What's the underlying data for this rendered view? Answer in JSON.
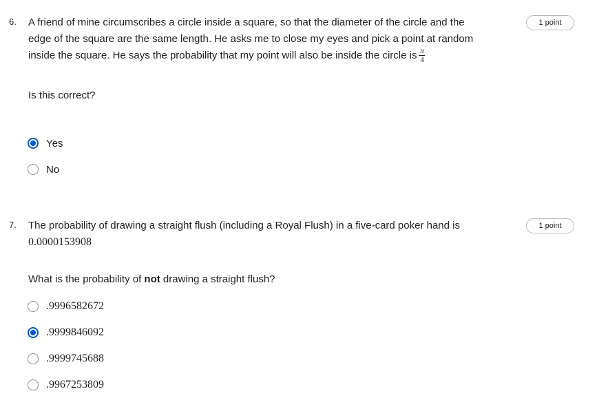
{
  "questions": [
    {
      "number": "6.",
      "points": "1 point",
      "text_lines": [
        "A friend of mine circumscribes a circle inside a square, so that the diameter of the circle and the",
        "edge of the square are the same length. He asks me to close my eyes and pick a point at random",
        "inside the square. He says the probability that my point will also be inside the circle is"
      ],
      "fraction": {
        "numerator": "π",
        "denominator": "4"
      },
      "subquestion": "Is this correct?",
      "options": [
        {
          "label": "Yes",
          "selected": true
        },
        {
          "label": "No",
          "selected": false
        }
      ]
    },
    {
      "number": "7.",
      "points": "1 point",
      "text_line": "The probability of drawing a straight flush (including a Royal Flush) in a five-card poker hand is",
      "value": "0.0000153908",
      "subquestion_before": "What is the probability of ",
      "subquestion_bold": "not",
      "subquestion_after": " drawing a straight flush?",
      "options": [
        {
          "label": ".9996582672",
          "selected": false
        },
        {
          "label": ".9999846092",
          "selected": true
        },
        {
          "label": ".9999745688",
          "selected": false
        },
        {
          "label": ".9967253809",
          "selected": false
        }
      ]
    }
  ],
  "colors": {
    "accent": "#0056d2",
    "text": "#1f1f1f",
    "radio_border": "#8e8e8e",
    "badge_border": "#b9b9b9"
  }
}
